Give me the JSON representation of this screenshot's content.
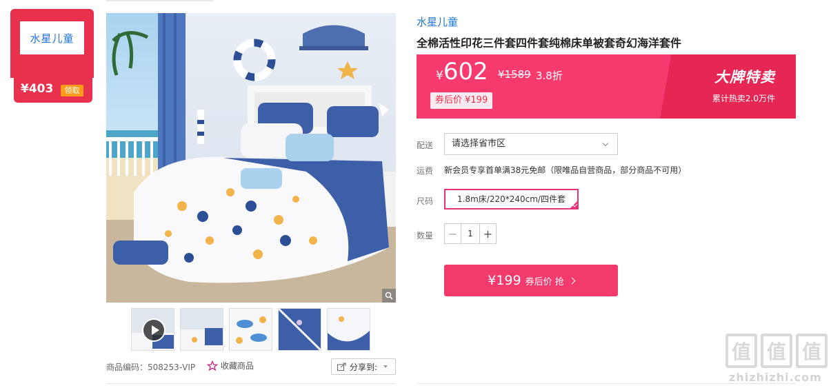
{
  "brand_badge": {
    "logo_text": "水星儿童",
    "price": "¥403",
    "claim_label": "领取"
  },
  "product": {
    "brand": "水星儿童",
    "title": "全棉活性印花三件套四件套纯棉床单被套奇幻海洋套件",
    "sku_label": "商品编码：508253-VIP",
    "favorite_label": "收藏商品",
    "share_label": "分享到:"
  },
  "pricing": {
    "currency": "¥",
    "price": "602",
    "original_price": "¥1589",
    "discount": "3.8折",
    "coupon_price": "券后价 ¥199",
    "campaign_title": "大牌特卖",
    "campaign_sub": "累计热卖2.0万件"
  },
  "options": {
    "delivery_label": "配送",
    "delivery_placeholder": "请选择省市区",
    "shipping_label": "运费",
    "shipping_text": "新会员专享首单满38元免邮（限唯品自营商品，部分商品不可用）",
    "size_label": "尺码",
    "size_value": "1.8m床/220*240cm/四件套",
    "qty_label": "数量",
    "qty_minus": "−",
    "qty_value": "1",
    "qty_plus": "+"
  },
  "buy_button": {
    "price": "¥199",
    "label": "券后价 抢"
  },
  "watermark": {
    "chars": [
      "值",
      "值",
      "值"
    ],
    "text": "zhizhizhi.com"
  },
  "colors": {
    "accent": "#f23a6c",
    "brand_red": "#e8314d",
    "link_blue": "#1a75d2",
    "bedding_blue": "#3d5fa8"
  }
}
